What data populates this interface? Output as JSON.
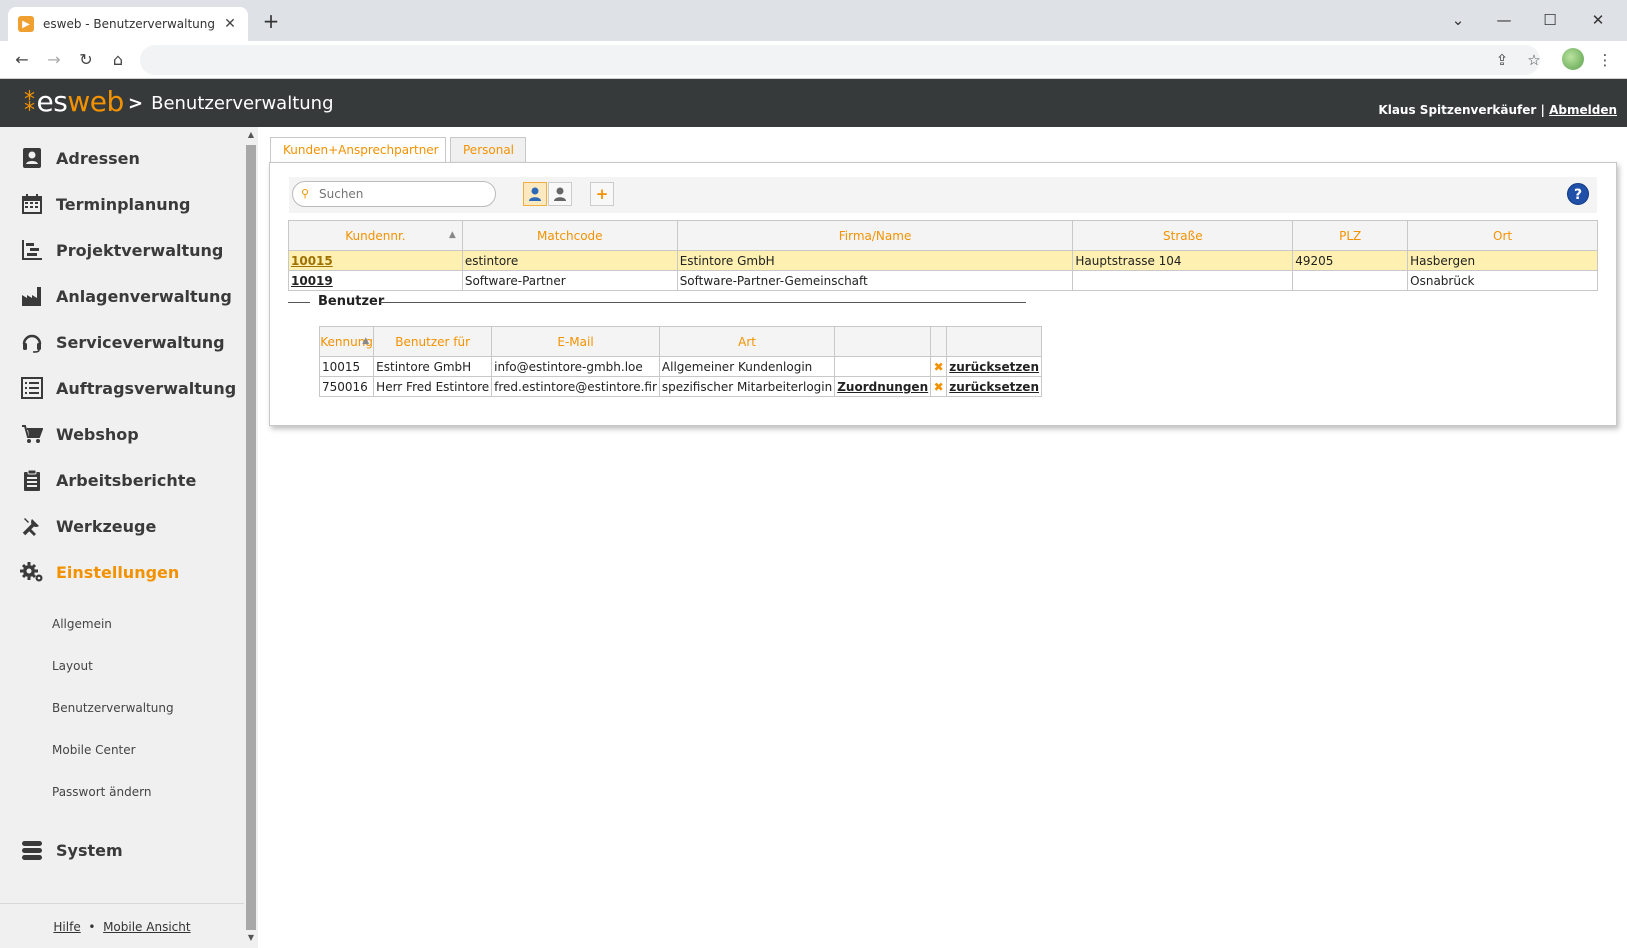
{
  "browser": {
    "tab_title": "esweb - Benutzerverwaltung",
    "new_tab_icon": "plus-icon",
    "address": ""
  },
  "header": {
    "logo_es": "es",
    "logo_web": "web",
    "breadcrumb_separator": ">",
    "breadcrumb": "Benutzerverwaltung",
    "user_name": "Klaus Spitzenverkäufer",
    "user_separator": "|",
    "logout": "Abmelden"
  },
  "sidebar": {
    "items": [
      {
        "label": "Adressen",
        "icon": "address-card-icon"
      },
      {
        "label": "Terminplanung",
        "icon": "calendar-icon"
      },
      {
        "label": "Projektverwaltung",
        "icon": "gantt-icon"
      },
      {
        "label": "Anlagenverwaltung",
        "icon": "factory-icon"
      },
      {
        "label": "Serviceverwaltung",
        "icon": "headset-icon"
      },
      {
        "label": "Auftragsverwaltung",
        "icon": "list-icon"
      },
      {
        "label": "Webshop",
        "icon": "cart-icon"
      },
      {
        "label": "Arbeitsberichte",
        "icon": "clipboard-icon"
      },
      {
        "label": "Werkzeuge",
        "icon": "tools-icon"
      },
      {
        "label": "Einstellungen",
        "icon": "gears-icon"
      },
      {
        "label": "System",
        "icon": "database-icon"
      }
    ],
    "subitems": [
      "Allgemein",
      "Layout",
      "Benutzerverwaltung",
      "Mobile Center",
      "Passwort ändern"
    ],
    "footer": {
      "help": "Hilfe",
      "dot": "•",
      "mobile": "Mobile Ansicht"
    }
  },
  "tabs": [
    "Kunden+Ansprechpartner",
    "Personal"
  ],
  "search": {
    "placeholder": "Suchen",
    "add": "+",
    "help": "?"
  },
  "customers": {
    "columns": [
      "Kundennr.",
      "Matchcode",
      "Firma/Name",
      "Straße",
      "PLZ",
      "Ort"
    ],
    "rows": [
      [
        "10015",
        "estintore",
        "Estintore GmbH",
        "Hauptstrasse 104",
        "49205",
        "Hasbergen"
      ],
      [
        "10019",
        "Software-Partner",
        "Software-Partner-Gemeinschaft",
        "",
        "",
        "Osnabrück"
      ]
    ]
  },
  "users": {
    "legend": "Benutzer",
    "columns": [
      "Kennung",
      "Benutzer für",
      "E-Mail",
      "Art",
      "",
      "",
      ""
    ],
    "rows": [
      [
        "10015",
        "Estintore GmbH",
        "info@estintore-gmbh.loe",
        "Allgemeiner Kundenlogin",
        "",
        "✖",
        "zurücksetzen"
      ],
      [
        "750016",
        "Herr Fred Estintore",
        "fred.estintore@estintore.fir",
        "spezifischer Mitarbeiterlogin",
        "Zuordnungen",
        "✖",
        "zurücksetzen"
      ]
    ]
  },
  "colors": {
    "accent": "#f39200",
    "header_bg": "#363a3a",
    "selected_row": "#fdf0b0"
  }
}
